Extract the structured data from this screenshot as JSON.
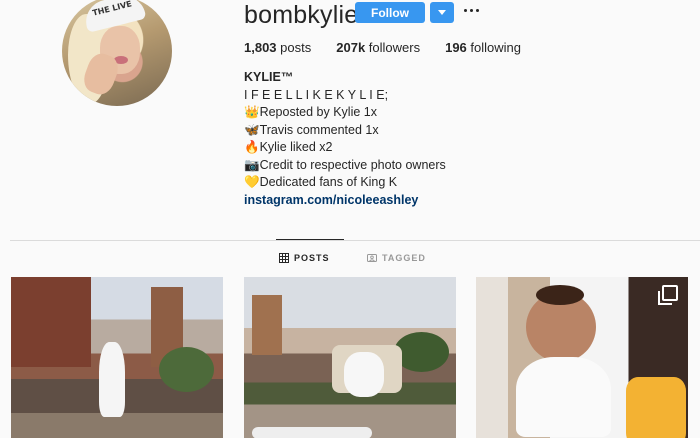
{
  "profile": {
    "username": "bombkylie",
    "cap_text": "THE LIVE",
    "follow_label": "Follow",
    "stats": {
      "posts_count": "1,803",
      "posts_label": "posts",
      "followers_count": "207k",
      "followers_label": "followers",
      "following_count": "196",
      "following_label": "following"
    },
    "bio": {
      "name": "KYLIE™",
      "lines": [
        "I F E E L L I K E K Y L I E;",
        "👑Reposted by Kylie 1x",
        "🦋Travis commented 1x",
        "🔥Kylie liked x2",
        "📷Credit to respective photo owners",
        "💛Dedicated fans of King K"
      ],
      "link": "instagram.com/nicoleeashley"
    }
  },
  "tabs": [
    {
      "label": "POSTS",
      "active": true
    },
    {
      "label": "TAGGED",
      "active": false
    }
  ],
  "colors": {
    "accent": "#3897f0",
    "link": "#003569"
  }
}
